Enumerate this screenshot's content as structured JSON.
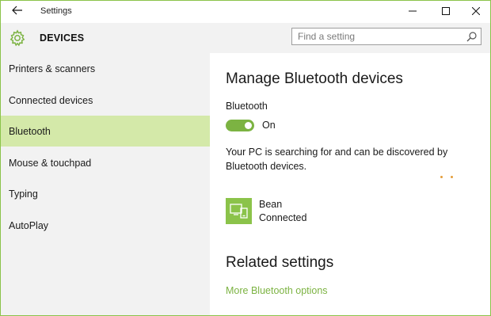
{
  "window": {
    "title": "Settings",
    "back_icon": "back-arrow-icon",
    "controls": [
      "minimize-icon",
      "maximize-icon",
      "close-icon"
    ]
  },
  "header": {
    "icon": "gear-icon",
    "title": "DEVICES",
    "search": {
      "placeholder": "Find a setting",
      "icon": "search-icon"
    }
  },
  "sidebar": {
    "items": [
      {
        "label": "Printers & scanners",
        "active": false
      },
      {
        "label": "Connected devices",
        "active": false
      },
      {
        "label": "Bluetooth",
        "active": true
      },
      {
        "label": "Mouse & touchpad",
        "active": false
      },
      {
        "label": "Typing",
        "active": false
      },
      {
        "label": "AutoPlay",
        "active": false
      }
    ]
  },
  "main": {
    "title": "Manage Bluetooth devices",
    "bluetooth_label": "Bluetooth",
    "toggle": {
      "state": "on",
      "label": "On"
    },
    "description": "Your PC is searching for and can be discovered by Bluetooth devices.",
    "device": {
      "icon": "paired-device-icon",
      "name": "Bean",
      "status": "Connected"
    },
    "related_title": "Related settings",
    "related_link": "More Bluetooth options"
  },
  "colors": {
    "accent": "#7cb342",
    "sidebar_bg": "#f2f2f2",
    "active_item_bg": "#d4e9a9",
    "progress_dots": "#e49e3a"
  }
}
